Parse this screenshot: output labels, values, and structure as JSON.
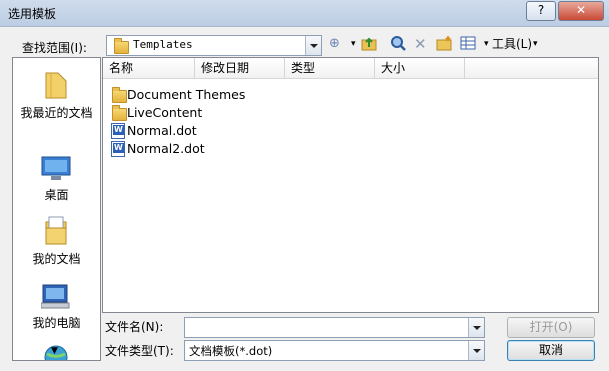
{
  "window": {
    "title": "选用模板",
    "help_label": "?",
    "close_label": "✕"
  },
  "toolbar": {
    "look_in_label": "查找范围(I):",
    "look_in_value": "Templates",
    "tools_label": "工具(L)"
  },
  "places": [
    {
      "label": "我最近的文档",
      "icon": "recent-documents-icon"
    },
    {
      "label": "桌面",
      "icon": "desktop-icon"
    },
    {
      "label": "我的文档",
      "icon": "my-documents-icon"
    },
    {
      "label": "我的电脑",
      "icon": "my-computer-icon"
    }
  ],
  "columns": [
    "名称",
    "修改日期",
    "类型",
    "大小"
  ],
  "files": [
    {
      "name": "Document Themes",
      "type": "folder"
    },
    {
      "name": "LiveContent",
      "type": "folder"
    },
    {
      "name": "Normal.dot",
      "type": "word-template"
    },
    {
      "name": "Normal2.dot",
      "type": "word-template"
    }
  ],
  "filename": {
    "label": "文件名(N):",
    "value": ""
  },
  "filetype": {
    "label": "文件类型(T):",
    "value": "文档模板(*.dot)"
  },
  "buttons": {
    "open": "打开(O)",
    "cancel": "取消"
  },
  "colors": {
    "accent": "#2b5fb8",
    "folder": "#f2c94c",
    "titlebar": "#c4d4e8"
  }
}
